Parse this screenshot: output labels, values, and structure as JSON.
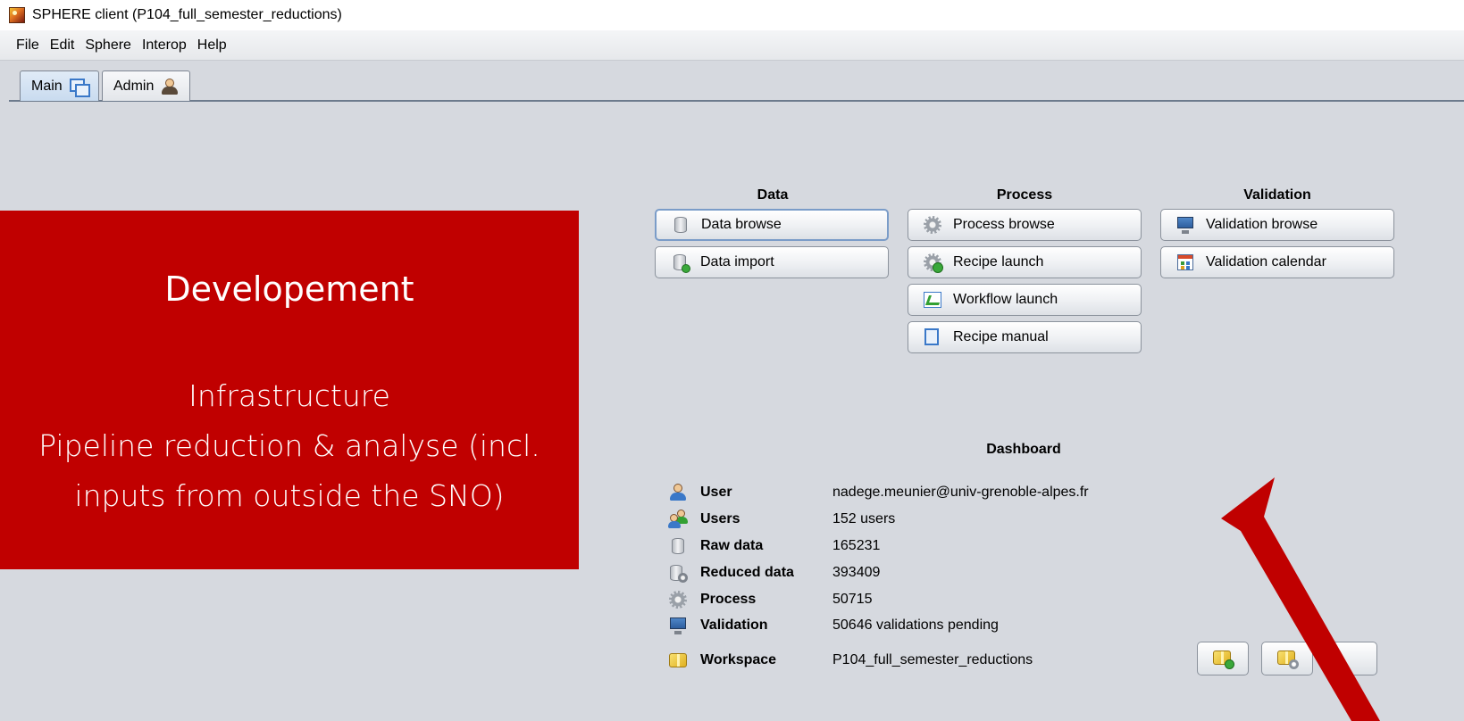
{
  "window": {
    "title": "SPHERE client (P104_full_semester_reductions)"
  },
  "menu": [
    "File",
    "Edit",
    "Sphere",
    "Interop",
    "Help"
  ],
  "tabs": [
    {
      "label": "Main",
      "icon": "windows-icon",
      "active": true
    },
    {
      "label": "Admin",
      "icon": "admin-person-icon",
      "active": false
    }
  ],
  "overlay": {
    "title": "Developement",
    "lines": [
      "Infrastructure",
      "Pipeline reduction & analyse (incl.",
      "inputs from outside the SNO)"
    ],
    "color": "#c00000"
  },
  "sections": {
    "data": {
      "title": "Data",
      "buttons": [
        "Data browse",
        "Data import"
      ]
    },
    "process": {
      "title": "Process",
      "buttons": [
        "Process browse",
        "Recipe launch",
        "Workflow launch",
        "Recipe manual"
      ]
    },
    "validation": {
      "title": "Validation",
      "buttons": [
        "Validation browse",
        "Validation calendar"
      ]
    }
  },
  "dashboard": {
    "title": "Dashboard",
    "rows": [
      {
        "label": "User",
        "value": "nadege.meunier@univ-grenoble-alpes.fr",
        "icon": "user-icon"
      },
      {
        "label": "Users",
        "value": "152 users",
        "icon": "users-icon"
      },
      {
        "label": "Raw data",
        "value": "165231",
        "icon": "database-icon"
      },
      {
        "label": "Reduced data",
        "value": "393409",
        "icon": "reduced-data-icon"
      },
      {
        "label": "Process",
        "value": "50715",
        "icon": "gear-icon"
      },
      {
        "label": "Validation",
        "value": "50646 validations pending",
        "icon": "monitor-icon"
      },
      {
        "label": "Workspace",
        "value": "P104_full_semester_reductions",
        "icon": "workspace-box-icon"
      }
    ]
  },
  "annotation_arrow_color": "#c00000"
}
